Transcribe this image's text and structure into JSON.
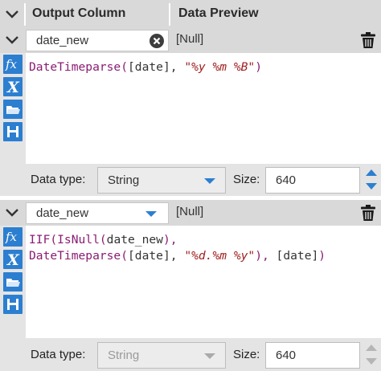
{
  "header": {
    "output_column": "Output Column",
    "data_preview": "Data Preview"
  },
  "rows": [
    {
      "name": "date_new",
      "name_control": "text-with-clear",
      "preview": "[Null]",
      "expression_lines": [
        [
          {
            "t": "fn",
            "v": "DateTimeparse("
          },
          {
            "t": "plain",
            "v": "[date], "
          },
          {
            "t": "str",
            "v": "\"%y %m %B\""
          },
          {
            "t": "fn",
            "v": ")"
          }
        ]
      ],
      "data_type_label": "Data type:",
      "data_type": "String",
      "data_type_enabled": true,
      "size_label": "Size:",
      "size": "640",
      "size_enabled": true
    },
    {
      "name": "date_new",
      "name_control": "dropdown",
      "preview": "[Null]",
      "expression_lines": [
        [
          {
            "t": "fn",
            "v": "IIF(IsNull("
          },
          {
            "t": "plain",
            "v": "date_new"
          },
          {
            "t": "fn",
            "v": "),"
          }
        ],
        [
          {
            "t": "fn",
            "v": "DateTimeparse("
          },
          {
            "t": "plain",
            "v": "[date], "
          },
          {
            "t": "str",
            "v": "\"%d.%m %y\""
          },
          {
            "t": "fn",
            "v": "), "
          },
          {
            "t": "plain",
            "v": "[date]"
          },
          {
            "t": "fn",
            "v": ")"
          }
        ]
      ],
      "data_type_label": "Data type:",
      "data_type": "String",
      "data_type_enabled": false,
      "size_label": "Size:",
      "size": "640",
      "size_enabled": false
    }
  ],
  "icons": [
    "chevron-down-icon",
    "clear-icon",
    "trash-icon",
    "function-fx-icon",
    "variable-x-icon",
    "folder-open-icon",
    "save-icon"
  ],
  "colors": {
    "accent": "#2c7fd0",
    "function_text": "#8b1c72",
    "string_text": "#a02020",
    "panel_bg": "#e4e4e4",
    "header_bg": "#d9d9d9"
  }
}
